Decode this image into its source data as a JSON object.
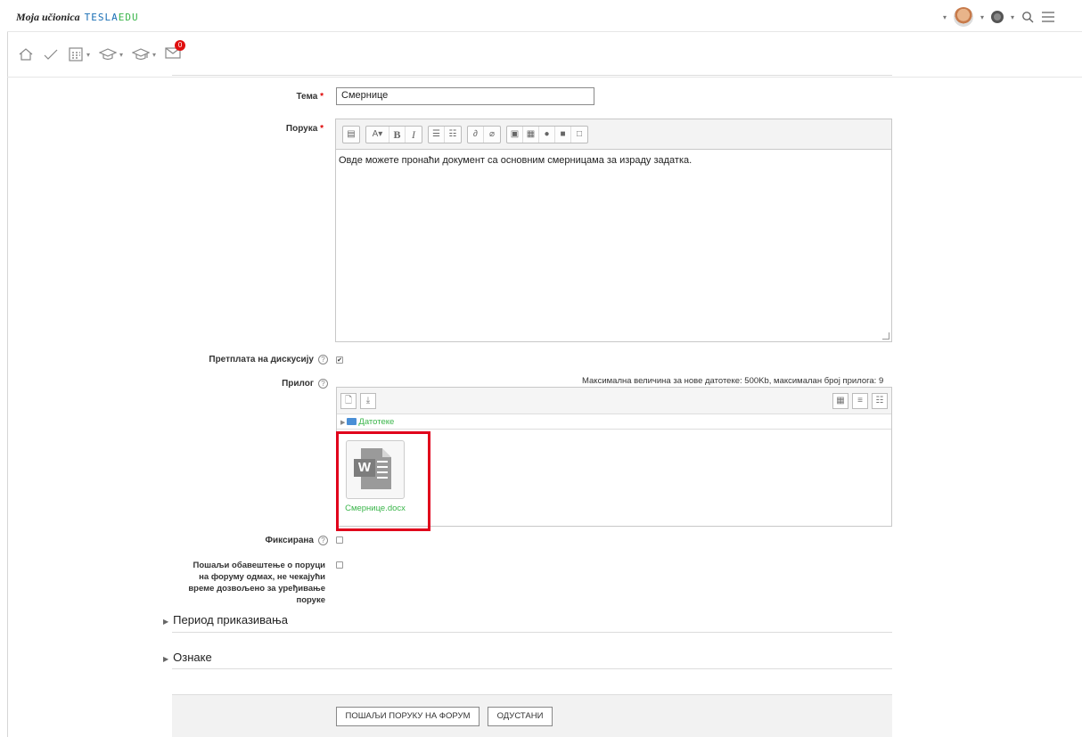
{
  "header": {
    "brand_script": "Moja učionica",
    "brand_tesla": "TESLA",
    "brand_edu": "EDU",
    "user_menu_caret": "▾",
    "lang_menu_caret": "▾",
    "icons": [
      "avatar",
      "globe-icon",
      "search-icon",
      "menu-icon"
    ]
  },
  "nav": {
    "icons": [
      "home-icon",
      "check-icon",
      "calendar-icon",
      "graduation-cap-icon",
      "graduation-cap-outline-icon",
      "mail-icon"
    ],
    "mail_badge": "0"
  },
  "form": {
    "subject_label": "Тема",
    "subject_value": "Смернице",
    "message_label": "Порука",
    "message_text": "Овде можете пронаћи документ са основним смерницама за израду задатка.",
    "subscription_label": "Претплата на дискусију",
    "subscription_checked": true,
    "attachment_label": "Прилог",
    "attachment_limits": "Максимална величина за нове датотеке: 500Kb, максималан број прилога: 9",
    "files_folder": "Датотеке",
    "file_name": "Смернице.docx",
    "pinned_label": "Фиксирана",
    "pinned_checked": false,
    "notify_label": "Пошаљи обавештење о поруци на форуму одмах, не чекајући време дозвољено за уређивање поруке",
    "notify_checked": false,
    "section_display_period": "Период приказивања",
    "section_tags": "Ознаке",
    "submit_label": "ПОШАЉИ ПОРУКУ НА ФОРУМ",
    "cancel_label": "ОДУСТАНИ"
  },
  "colors": {
    "accent_green": "#3ab54a",
    "highlight_red": "#e0001b",
    "badge_red": "#e01010"
  }
}
